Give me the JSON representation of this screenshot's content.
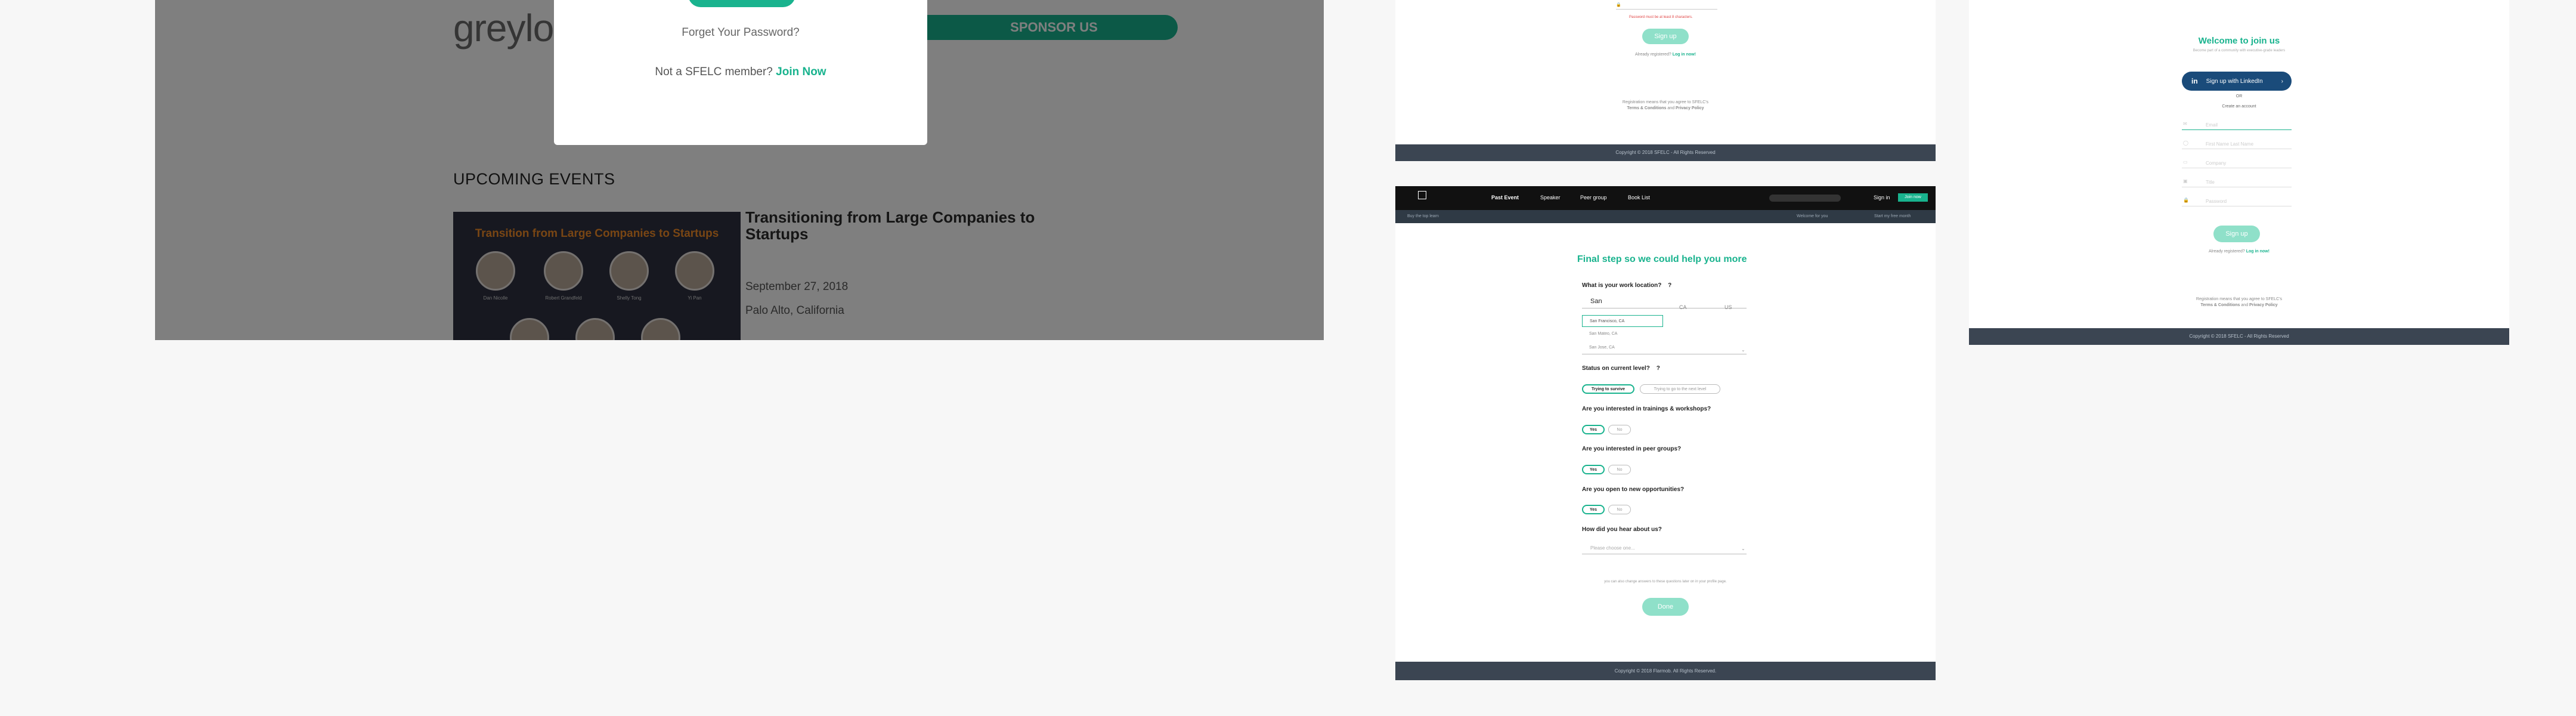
{
  "left": {
    "logo_text": "greyloc",
    "sponsor_label": "SPONSOR US",
    "section_title": "UPCOMING EVENTS",
    "event": {
      "image_title": "Transition from Large Companies to Startups",
      "speakers": [
        "Dan Nicolle",
        "Robert Grandfeld",
        "Shelly Tong",
        "Yi Pan",
        "",
        "",
        ""
      ],
      "title": "Transitioning from Large Companies to Startups",
      "date": "September 27, 2018",
      "location": "Palo Alto, California"
    },
    "modal": {
      "forget_password": "Forget Your Password?",
      "not_member": "Not a SFELC member?",
      "join_now": "Join Now"
    }
  },
  "midtop": {
    "error_text": "Password must be at least 8 characters.",
    "signup_label": "Sign up",
    "already": "Already registered?",
    "login_link": "Log in now!",
    "terms_line1": "Registration means that you agree to SFELC's",
    "terms_line2": "Terms & Conditions",
    "terms_and": "and",
    "terms_privacy": "Privacy Policy",
    "copyright": "Copyright © 2018 SFELC - All Rights Reserved"
  },
  "mid": {
    "nav": {
      "items": [
        "Past Event",
        "Speaker",
        "Peer group",
        "Book List"
      ],
      "signin": "Sign in",
      "join": "Join now"
    },
    "subnav": {
      "left": "Buy the top learn",
      "center": "Welcome for you",
      "right": "Start my free month"
    },
    "heading": "Final step so we could help you more",
    "q_location": "What is your work location?",
    "location_input": "San",
    "state_value": "CA",
    "country_value": "US",
    "suggestions": [
      "San Francisco, CA",
      "San Mateo, CA",
      "San Jose, CA"
    ],
    "q_status": "Status on current level?",
    "status_options": [
      "Trying to survive",
      "Trying to go to the next level"
    ],
    "q_trainings": "Are you interested in trainings & workshops?",
    "q_peer": "Are you interested in peer groups?",
    "q_opportunities": "Are you open to new opportunities?",
    "yes": "Yes",
    "no": "No",
    "q_hear": "How did you hear about us?",
    "hear_placeholder": "Please choose one...",
    "note": "you can also change answers to these questions later on in your profile page.",
    "done_label": "Done",
    "copyright": "Copyright © 2018 Flarmob. All Rights Reserved."
  },
  "right": {
    "welcome": "Welcome to join us",
    "subtitle": "Become part of a community with executive-grade leaders",
    "linkedin_label": "Sign up with LinkedIn",
    "or": "OR",
    "create": "Create an account",
    "fields": [
      "Email",
      "First Name   Last Name",
      "Company",
      "Title",
      "Password"
    ],
    "signup_label": "Sign up",
    "already": "Already registered?",
    "login_link": "Log in now!",
    "terms_line1": "Registration means that you agree to SFELC's",
    "terms_line2": "Terms & Conditions",
    "terms_and": "and",
    "terms_privacy": "Privacy Policy",
    "copyright": "Copyright © 2018 SFELC - All Rights Reserved"
  },
  "colors": {
    "accent": "#19b38e",
    "dark_bar": "#3b4552",
    "linkedin": "#1a4b7a"
  }
}
